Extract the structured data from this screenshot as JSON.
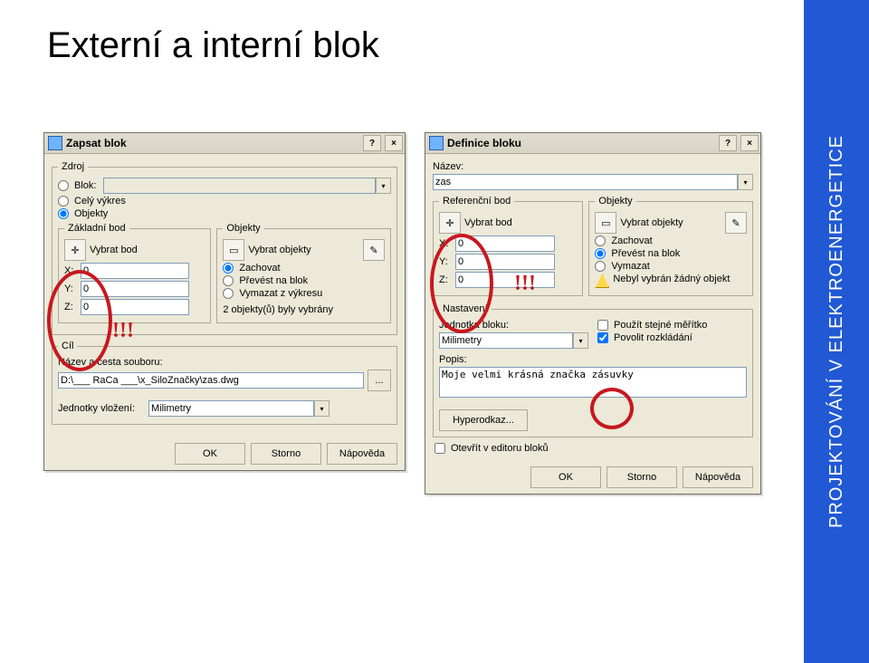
{
  "page_title": "Externí a interní blok",
  "sidebar_text": "PROJEKTOVÁNÍ V ELEKTROENERGETICE",
  "annotation": "!!!",
  "dlg1": {
    "title": "Zapsat blok",
    "src_legend": "Zdroj",
    "src_block": "Blok:",
    "src_block_val": "",
    "src_whole": "Celý výkres",
    "src_objects": "Objekty",
    "base_legend": "Základní bod",
    "pick_point": "Vybrat bod",
    "x_lbl": "X:",
    "x_val": "0",
    "y_lbl": "Y:",
    "y_val": "0",
    "z_lbl": "Z:",
    "z_val": "0",
    "obj_legend": "Objekty",
    "pick_objs": "Vybrat objekty",
    "keep": "Zachovat",
    "convert": "Převést na blok",
    "delete": "Vymazat z výkresu",
    "count": "2 objekty(ů) byly vybrány",
    "dest_legend": "Cíl",
    "path_lbl": "Název a cesta souboru:",
    "path_val": "D:\\___ RaCa ___\\x_SiloZnačky\\zas.dwg",
    "browse": "...",
    "units_lbl": "Jednotky vložení:",
    "units_val": "Milimetry",
    "ok": "OK",
    "cancel": "Storno",
    "help": "Nápověda"
  },
  "dlg2": {
    "title": "Definice bloku",
    "name_lbl": "Název:",
    "name_val": "zas",
    "ref_legend": "Referenční bod",
    "pick_point": "Vybrat bod",
    "x_lbl": "X:",
    "x_val": "0",
    "y_lbl": "Y:",
    "y_val": "0",
    "z_lbl": "Z:",
    "z_val": "0",
    "obj_legend": "Objekty",
    "pick_objs": "Vybrat objekty",
    "keep": "Zachovat",
    "convert": "Převést na blok",
    "delete": "Vymazat",
    "warn": "Nebyl vybrán žádný objekt",
    "set_legend": "Nastavení",
    "unit_lbl": "Jednotka bloku:",
    "unit_val": "Milimetry",
    "same_scale": "Použít stejné měřítko",
    "allow_explode": "Povolit rozkládání",
    "desc_lbl": "Popis:",
    "desc_val": "Moje velmi krásná značka zásuvky",
    "hyperlink": "Hyperodkaz...",
    "open_editor": "Otevřít v editoru bloků",
    "ok": "OK",
    "cancel": "Storno",
    "help": "Nápověda"
  }
}
